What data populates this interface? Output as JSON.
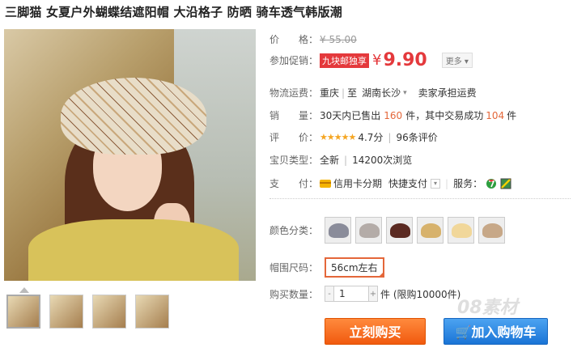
{
  "product": {
    "title": "三脚猫 女夏户外蝴蝶结遮阳帽 大沿格子 防晒 骑车透气韩版潮"
  },
  "gallery": {
    "main_image": "woman-in-plaid-sun-hat",
    "thumbnail_count": 4
  },
  "price": {
    "label": "价　　格：",
    "original": "¥ 55.00"
  },
  "promotion": {
    "label": "参加促销：",
    "badge": "九块邮独享",
    "currency": "¥",
    "price": "9.90",
    "more": "更多 ▾"
  },
  "shipping": {
    "label": "物流运费：",
    "from": "重庆",
    "separator": "|",
    "to_prefix": "至",
    "to": "湖南长沙",
    "arrow": "▾",
    "fee": "卖家承担运费"
  },
  "sales": {
    "label": "销　　量：",
    "prefix": "30天内已售出",
    "sold": "160",
    "mid": "件，其中交易成功",
    "success": "104",
    "suffix": "件"
  },
  "rating": {
    "label": "评　　价：",
    "stars": "★★★★★",
    "score": "4.7分",
    "sep": "|",
    "reviews": "96条评价"
  },
  "product_type": {
    "label": "宝贝类型：",
    "value": "全新",
    "sep": "|",
    "views": "14200次浏览"
  },
  "payment": {
    "label": "支　　付：",
    "credit": "信用卡分期",
    "quick": "快捷支付",
    "dd": "▾",
    "service_label": "服务："
  },
  "colors": {
    "label": "颜色分类：",
    "swatch_colors": [
      "#8a8c9a",
      "#b4aca8",
      "#5b2a22",
      "#d7b26c",
      "#f1d79a",
      "#c7a888"
    ]
  },
  "size": {
    "label": "帽围尺码：",
    "value": "56cm左右"
  },
  "quantity": {
    "label": "购买数量：",
    "minus": "-",
    "value": "1",
    "plus": "+",
    "note": "件 (限购10000件)"
  },
  "actions": {
    "buy": "立刻购买",
    "cart": "加入购物车"
  },
  "watermark": "08素材"
}
